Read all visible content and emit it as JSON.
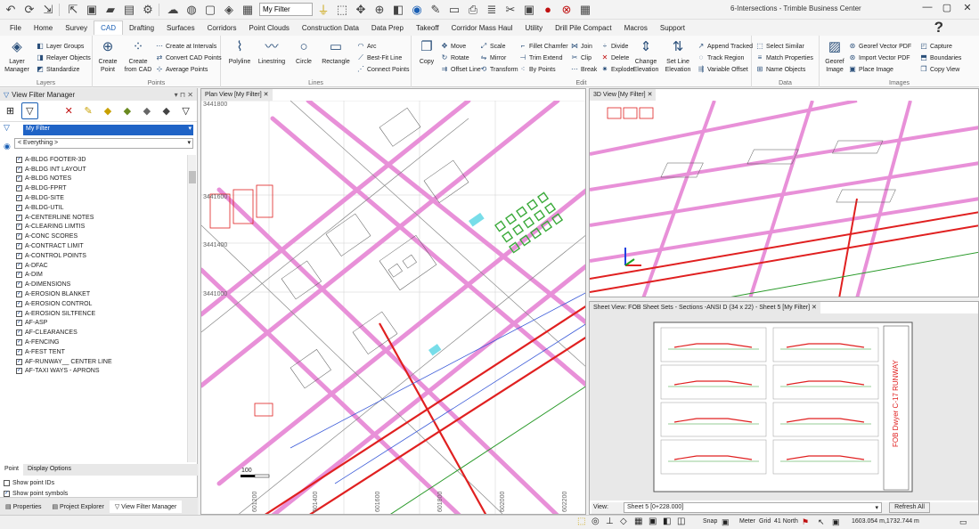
{
  "qat": {
    "filter": "My Filter"
  },
  "app_title": "6-Intersections - Trimble Business Center",
  "tabs": [
    "File",
    "Home",
    "Survey",
    "CAD",
    "Drafting",
    "Surfaces",
    "Corridors",
    "Point Clouds",
    "Construction Data",
    "Data Prep",
    "Takeoff",
    "Corridor Mass Haul",
    "Utility",
    "Drill Pile Compact",
    "Macros",
    "Support"
  ],
  "ribbon": {
    "layers": {
      "label": "Layers",
      "layer_manager": "Layer Manager",
      "layer_groups": "Layer Groups",
      "relayer_objects": "Relayer Objects",
      "standardize": "Standardize"
    },
    "points": {
      "label": "Points",
      "create_point": "Create Point",
      "create_from_cad": "Create from CAD",
      "create_at_intervals": "Create at Intervals",
      "convert_cad_points": "Convert CAD Points",
      "average_points": "Average Points"
    },
    "lines": {
      "label": "Lines",
      "polyline": "Polyline",
      "linestring": "Linestring",
      "circle": "Circle",
      "rectangle": "Rectangle",
      "arc": "Arc",
      "best_fit_line": "Best-Fit Line",
      "connect_points": "Connect Points"
    },
    "edit": {
      "label": "Edit",
      "copy": "Copy",
      "move": "Move",
      "rotate": "Rotate",
      "offset_line": "Offset Line",
      "scale": "Scale",
      "mirror": "Mirror",
      "transform": "Transform",
      "fillet_chamfer": "Fillet Chamfer",
      "trim_extend": "Trim Extend",
      "by_points": "By Points",
      "join": "Join",
      "clip": "Clip",
      "break": "Break",
      "divide": "Divide",
      "delete": "Delete",
      "explode": "Explode",
      "change_elevation": "Change Elevation",
      "set_line_elevation": "Set Line Elevation",
      "append_tracked": "Append Tracked",
      "track_region": "Track Region",
      "variable_offset": "Variable Offset"
    },
    "data": {
      "label": "Data",
      "select_similar": "Select Similar",
      "match_properties": "Match Properties",
      "name_objects": "Name Objects"
    },
    "images": {
      "label": "Images",
      "georef_image": "Georef Image",
      "georef_vector_pdf": "Georef Vector PDF",
      "import_vector_pdf": "Import Vector PDF",
      "place_image": "Place Image",
      "capture": "Capture",
      "boundaries": "Boundaries",
      "copy_view": "Copy View"
    }
  },
  "left_panel": {
    "title": "View Filter Manager",
    "filter": "My Filter",
    "everything": "< Everything >",
    "layers": [
      "A-BLDG FOOTER-3D",
      "A-BLDG INT LAYOUT",
      "A-BLDG NOTES",
      "A-BLDG-FPRT",
      "A-BLDG-SITE",
      "A-BLDG-UTIL",
      "A-CENTERLINE NOTES",
      "A-CLEARING LIMTIS",
      "A-CONC SCORES",
      "A-CONTRACT LIMIT",
      "A-CONTROL POINTS",
      "A-DFAC",
      "A-DIM",
      "A-DIMENSIONS",
      "A-EROSION BLANKET",
      "A-EROSION CONTROL",
      "A-EROSION SILTFENCE",
      "AF-ASP",
      "AF-CLEARANCES",
      "A-FENCING",
      "A-FEST TENT",
      "AF-RUNWAY__ CENTER LINE",
      "AF-TAXI WAYS - APRONS"
    ],
    "subtabs": [
      "Point",
      "Display Options"
    ],
    "options": [
      {
        "label": "Show point IDs",
        "checked": false
      },
      {
        "label": "Show point symbols",
        "checked": true
      },
      {
        "label": "Show feature code",
        "checked": false
      },
      {
        "label": "Show elevation",
        "checked": false
      },
      {
        "label": "Show disconnected points",
        "checked": true
      },
      {
        "label": "Show feature symbol only",
        "checked": false
      }
    ],
    "bottom_tabs": [
      "Properties",
      "Project Explorer",
      "View Filter Manager"
    ]
  },
  "plan_view": {
    "tab": "Plan View [My Filter]",
    "northings": [
      "3441800",
      "3441600",
      "3441400",
      "3441000"
    ],
    "scale_label": "100",
    "eastings": [
      "601200",
      "601400",
      "601600",
      "601800",
      "602000",
      "602200"
    ]
  },
  "view_3d": {
    "tab": "3D View [My Filter]"
  },
  "sheet_view": {
    "tab": "Sheet View: FOB Sheet Sets - Sections -ANSI D (34 x 22) - Sheet 5 [My Filter]",
    "title_block": "FOB Dwyer C-17 RUNWAY",
    "view_label": "View:",
    "view_value": "Sheet 5 [0+228.000]",
    "refresh": "Refresh All"
  },
  "status": {
    "snap": "Snap",
    "meter": "Meter",
    "grid": "Grid",
    "north": "41 North",
    "coords": "1603.054 m,1732.744 m"
  }
}
